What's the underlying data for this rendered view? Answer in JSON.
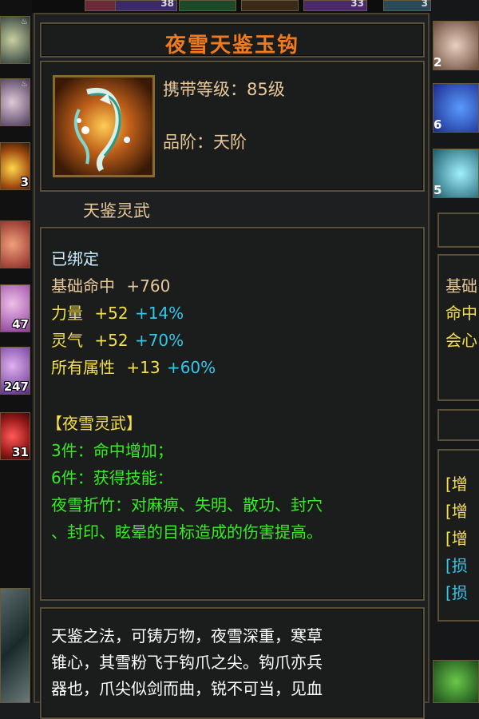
{
  "item": {
    "name": "夜雪天鉴玉钩",
    "carry_level": "携带等级：85级",
    "rank": "品阶：天阶",
    "category": "天鉴灵武"
  },
  "stats": {
    "bound": "已绑定",
    "base_hit": {
      "label": "基础命中",
      "value": "+760"
    },
    "attributes": [
      {
        "label": "力量",
        "value": "+52",
        "percent": "+14%"
      },
      {
        "label": "灵气",
        "value": "+52",
        "percent": "+70%"
      },
      {
        "label": "所有属性",
        "value": "+13",
        "percent": "+60%"
      }
    ],
    "set_name": "【夜雪灵武】",
    "set_bonuses": [
      "3件：命中增加；",
      "6件：获得技能：",
      "夜雪折竹：对麻痹、失明、散功、封穴",
      "、封印、眩晕的目标造成的伤害提高。"
    ]
  },
  "description": [
    "天鉴之法，可铸万物，夜雪深重，寒草",
    "锥心，其雪粉飞于钩爪之尖。钩爪亦兵",
    "器也，爪尖似剑而曲，锐不可当，见血"
  ],
  "inventory_left": {
    "counts": [
      "3",
      "47",
      "247",
      "31"
    ]
  },
  "top_strip": {
    "counts": [
      "38",
      "33",
      "3"
    ]
  },
  "right_panel": {
    "slot_counts": [
      "2",
      "6",
      "5"
    ],
    "stats_partial": [
      "基础",
      "命中",
      "会心"
    ],
    "buff_partial": [
      "[增",
      "[增",
      "[增",
      "[损",
      "[损"
    ]
  },
  "colors": {
    "title": "#f07a1e",
    "tan": "#e8c798",
    "gold": "#f4e04a",
    "green": "#33ee22",
    "blue": "#33c8e8",
    "frame": "#5a5038"
  }
}
